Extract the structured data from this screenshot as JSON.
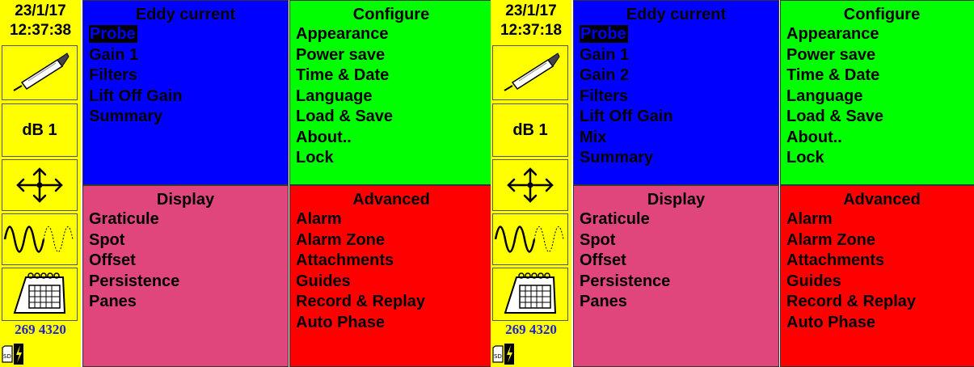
{
  "screens": [
    {
      "date": "23/1/17",
      "time": "12:37:38",
      "gain_label": "dB 1",
      "counter": "269 4320",
      "eddy": {
        "title": "Eddy current",
        "items": [
          "Probe",
          "Gain 1",
          "Filters",
          "Lift Off Gain",
          "Summary"
        ],
        "selected": 0
      },
      "configure": {
        "title": "Configure",
        "items": [
          "Appearance",
          "Power save",
          "Time & Date",
          "Language",
          "Load & Save",
          "About..",
          "Lock"
        ]
      },
      "display": {
        "title": "Display",
        "items": [
          "Graticule",
          "Spot",
          "Offset",
          "Persistence",
          "Panes"
        ]
      },
      "advanced": {
        "title": "Advanced",
        "items": [
          "Alarm",
          "Alarm Zone",
          "Attachments",
          "Guides",
          "Record & Replay",
          "Auto Phase"
        ]
      }
    },
    {
      "date": "23/1/17",
      "time": "12:37:18",
      "gain_label": "dB 1",
      "counter": "269 4320",
      "eddy": {
        "title": "Eddy current",
        "items": [
          "Probe",
          "Gain 1",
          "Gain 2",
          "Filters",
          "Lift Off Gain",
          "Mix",
          "Summary"
        ],
        "selected": 0
      },
      "configure": {
        "title": "Configure",
        "items": [
          "Appearance",
          "Power save",
          "Time & Date",
          "Language",
          "Load & Save",
          "About..",
          "Lock"
        ]
      },
      "display": {
        "title": "Display",
        "items": [
          "Graticule",
          "Spot",
          "Offset",
          "Persistence",
          "Panes"
        ]
      },
      "advanced": {
        "title": "Advanced",
        "items": [
          "Alarm",
          "Alarm Zone",
          "Attachments",
          "Guides",
          "Record & Replay",
          "Auto Phase"
        ]
      }
    }
  ],
  "colors": {
    "sidebar": "#ffff00",
    "eddy": "#0000ff",
    "configure": "#00ff00",
    "display": "#e0457b",
    "advanced": "#ff0000",
    "counter": "#2222cc"
  },
  "icons": [
    "probe-icon",
    "move-arrows-icon",
    "waveform-icon",
    "calendar-icon",
    "sd-card-icon",
    "charging-icon"
  ]
}
